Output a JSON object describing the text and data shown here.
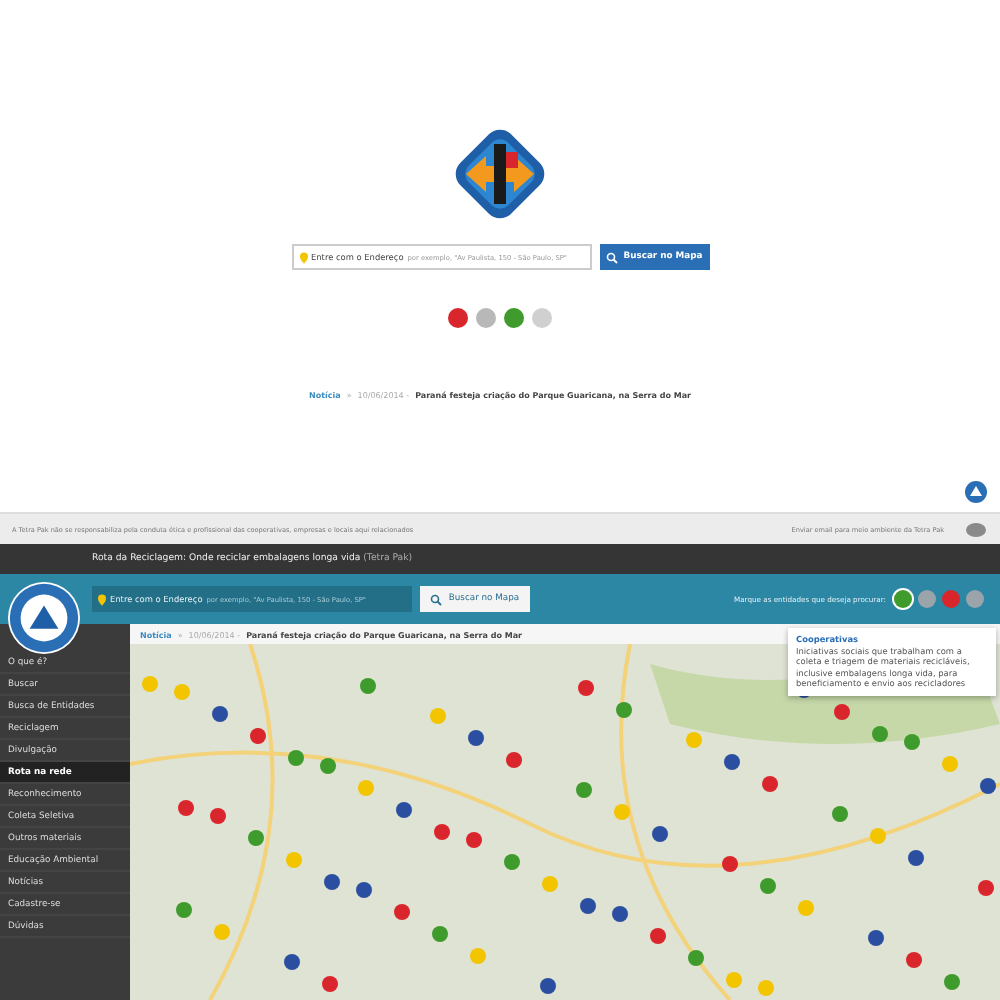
{
  "home": {
    "search": {
      "label": "Entre com o Endereço",
      "placeholder": "por exemplo, \"Av Paulista, 150 - São Paulo, SP\""
    },
    "search_button": "Buscar no Mapa",
    "filters": [
      {
        "color": "#d9262c"
      },
      {
        "color": "#b8b8b8"
      },
      {
        "color": "#3f9b2c"
      },
      {
        "color": "#d0d0d0"
      }
    ],
    "news": {
      "section": "Notícia",
      "separator": "»",
      "date": "10/06/2014 -",
      "title": "Paraná festeja criação do Parque Guaricana, na Serra do Mar"
    }
  },
  "footer": {
    "disclaimer": "A Tetra Pak não se responsabiliza pela conduta ética e profissional das cooperativas, empresas e locais aqui relacionados",
    "email_link": "Enviar email para meio ambiente da Tetra Pak"
  },
  "app": {
    "title": "Rota da Reciclagem: Onde reciclar embalagens longa vida",
    "title_suffix": "(Tetra Pak)",
    "search": {
      "label": "Entre com o Endereço",
      "placeholder": "por exemplo, \"Av Paulista, 150 - São Paulo, SP\""
    },
    "search_button": "Buscar no Mapa",
    "filter_label": "Marque as entidades que deseja procurar:",
    "filters": [
      {
        "color": "#3f9b2c",
        "selected": true
      },
      {
        "color": "#9aa4aa",
        "selected": false
      },
      {
        "color": "#d9262c",
        "selected": false
      },
      {
        "color": "#9aa4aa",
        "selected": false
      }
    ],
    "tooltip": {
      "title": "Cooperativas",
      "text": "Iniciativas sociais que trabalham com a coleta e triagem de materiais recicláveis, inclusive embalagens longa vida, para beneficiamento e envio aos recicladores"
    },
    "sidebar": [
      {
        "label": "O que é?",
        "selected": false
      },
      {
        "label": "Buscar",
        "selected": false
      },
      {
        "label": "Busca de Entidades",
        "selected": false
      },
      {
        "label": "Reciclagem",
        "selected": false
      },
      {
        "label": "Divulgação",
        "selected": false
      },
      {
        "label": "Rota na rede",
        "selected": true
      },
      {
        "label": "Reconhecimento",
        "selected": false
      },
      {
        "label": "Coleta Seletiva",
        "selected": false
      },
      {
        "label": "Outros materiais",
        "selected": false
      },
      {
        "label": "Educação Ambiental",
        "selected": false
      },
      {
        "label": "Notícias",
        "selected": false
      },
      {
        "label": "Cadastre-se",
        "selected": false
      },
      {
        "label": "Dúvidas",
        "selected": false
      }
    ],
    "news": {
      "section": "Notícia",
      "separator": "»",
      "date": "10/06/2014 -",
      "title": "Paraná festeja criação do Parque Guaricana, na Serra do Mar"
    }
  }
}
